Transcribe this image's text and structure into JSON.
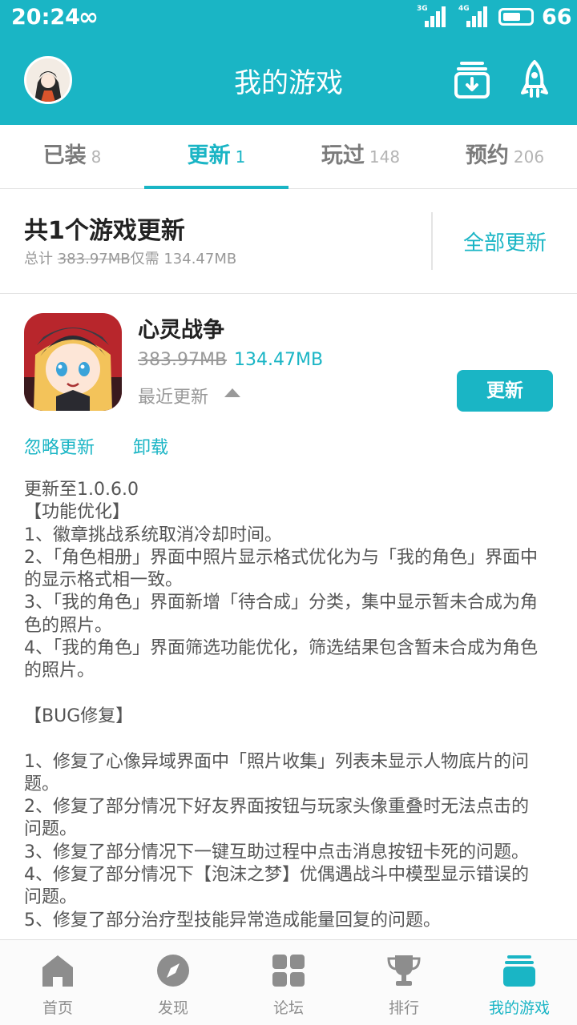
{
  "status_bar": {
    "time": "20:24",
    "sync_symbol": "∞",
    "signal1_label": "3G",
    "signal2_label": "4G",
    "battery_level": 66,
    "battery_text": "66"
  },
  "header": {
    "title": "我的游戏",
    "accent_color": "#1ab5c5",
    "download_icon": "download-box-icon",
    "rocket_icon": "rocket-icon"
  },
  "tabs": [
    {
      "label": "已装",
      "count": "8"
    },
    {
      "label": "更新",
      "count": "1"
    },
    {
      "label": "玩过",
      "count": "148"
    },
    {
      "label": "预约",
      "count": "206"
    }
  ],
  "summary": {
    "title": "共1个游戏更新",
    "prefix": "总计",
    "original_size": "383.97MB",
    "middle": "仅需",
    "new_size": "134.47MB",
    "update_all": "全部更新"
  },
  "game": {
    "name": "心灵战争",
    "original_size": "383.97MB",
    "new_size": "134.47MB",
    "recent": "最近更新",
    "update_button": "更新",
    "ignore": "忽略更新",
    "uninstall": "卸载",
    "notes": "更新至1.0.6.0\n【功能优化】\n1、徽章挑战系统取消冷却时间。\n2、「角色相册」界面中照片显示格式优化为与「我的角色」界面中的显示格式相一致。\n3、「我的角色」界面新增「待合成」分类，集中显示暂未合成为角色的照片。\n4、「我的角色」界面筛选功能优化，筛选结果包含暂未合成为角色的照片。\n\n【BUG修复】\n\n1、修复了心像异域界面中「照片收集」列表未显示人物底片的问题。\n2、修复了部分情况下好友界面按钮与玩家头像重叠时无法点击的问题。\n3、修复了部分情况下一键互助过程中点击消息按钮卡死的问题。\n4、修复了部分情况下【泡沫之梦】优偶遇战斗中模型显示错误的问题。\n5、修复了部分治疗型技能异常造成能量回复的问题。"
  },
  "bottom_nav": [
    {
      "label": "首页",
      "icon": "home-icon"
    },
    {
      "label": "发现",
      "icon": "compass-icon"
    },
    {
      "label": "论坛",
      "icon": "grid-icon"
    },
    {
      "label": "排行",
      "icon": "trophy-icon"
    },
    {
      "label": "我的游戏",
      "icon": "stack-icon"
    }
  ]
}
